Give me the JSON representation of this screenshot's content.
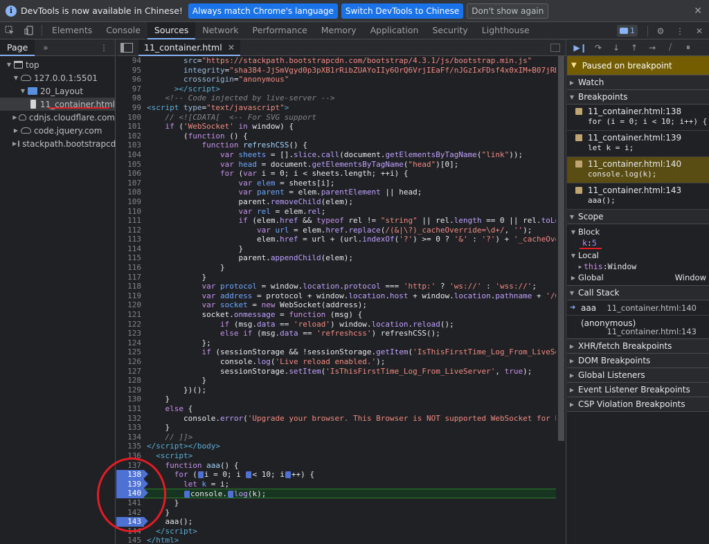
{
  "infobar": {
    "message": "DevTools is now available in Chinese!",
    "btn_match": "Always match Chrome's language",
    "btn_switch": "Switch DevTools to Chinese",
    "btn_dismiss": "Don't show again"
  },
  "tabs": [
    "Elements",
    "Console",
    "Sources",
    "Network",
    "Performance",
    "Memory",
    "Application",
    "Security",
    "Lighthouse"
  ],
  "active_tab": "Sources",
  "issues_count": "1",
  "navigator": {
    "tab": "Page",
    "tree": {
      "top": "top",
      "host": "127.0.0.1:5501",
      "folder": "20_Layout",
      "file": "11_container.html",
      "cdn1": "cdnjs.cloudflare.com",
      "cdn2": "code.jquery.com",
      "cdn3": "stackpath.bootstrapcdn"
    }
  },
  "editor": {
    "file_tab": "11_container.html"
  },
  "debugger": {
    "paused": "Paused on breakpoint",
    "sections": {
      "watch": "Watch",
      "breakpoints": "Breakpoints",
      "scope": "Scope",
      "call_stack": "Call Stack",
      "xhr": "XHR/fetch Breakpoints",
      "dom": "DOM Breakpoints",
      "global": "Global Listeners",
      "event": "Event Listener Breakpoints",
      "csp": "CSP Violation Breakpoints"
    },
    "breakpoints": [
      {
        "loc": "11_container.html:138",
        "code": "for (i = 0; i < 10; i++) {"
      },
      {
        "loc": "11_container.html:139",
        "code": "let k = i;"
      },
      {
        "loc": "11_container.html:140",
        "code": "console.log(k);"
      },
      {
        "loc": "11_container.html:143",
        "code": "aaa();"
      }
    ],
    "scope": {
      "block": "Block",
      "k_key": "k",
      "k_val": "5",
      "local": "Local",
      "this_key": "this",
      "this_val": "Window",
      "global": "Global",
      "global_val": "Window"
    },
    "call_stack": [
      {
        "fn": "aaa",
        "loc": "11_container.html:140"
      },
      {
        "fn": "(anonymous)",
        "loc": "11_container.html:143"
      }
    ]
  }
}
